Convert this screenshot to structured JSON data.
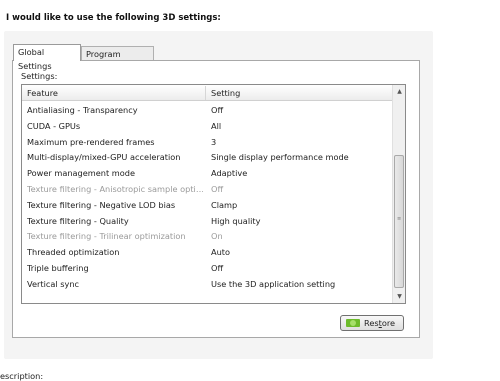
{
  "heading": "I would like to use the following 3D settings:",
  "tabs": [
    {
      "label": "Global Settings",
      "active": true
    },
    {
      "label": "Program Settings",
      "active": false
    }
  ],
  "settings_label": "Settings:",
  "columns": {
    "feature": "Feature",
    "setting": "Setting"
  },
  "rows": [
    {
      "feature": "Antialiasing - Transparency",
      "value": "Off",
      "disabled": false
    },
    {
      "feature": "CUDA - GPUs",
      "value": "All",
      "disabled": false
    },
    {
      "feature": "Maximum pre-rendered frames",
      "value": "3",
      "disabled": false
    },
    {
      "feature": "Multi-display/mixed-GPU acceleration",
      "value": "Single display performance mode",
      "disabled": false
    },
    {
      "feature": "Power management mode",
      "value": "Adaptive",
      "disabled": false
    },
    {
      "feature": "Texture filtering - Anisotropic sample opti…",
      "value": "Off",
      "disabled": true
    },
    {
      "feature": "Texture filtering - Negative LOD bias",
      "value": "Clamp",
      "disabled": false
    },
    {
      "feature": "Texture filtering - Quality",
      "value": "High quality",
      "disabled": false
    },
    {
      "feature": "Texture filtering - Trilinear optimization",
      "value": "On",
      "disabled": true
    },
    {
      "feature": "Threaded optimization",
      "value": "Auto",
      "disabled": false
    },
    {
      "feature": "Triple buffering",
      "value": "Off",
      "disabled": false
    },
    {
      "feature": "Vertical sync",
      "value": "Use the 3D application setting",
      "disabled": false
    }
  ],
  "restore_button": {
    "label_pre": "Res",
    "label_u": "t",
    "label_post": "ore",
    "icon": "nvidia-logo-icon"
  },
  "description_label": "escription:",
  "colors": {
    "panel": "#f4f4f4",
    "disabled_text": "#9a9a9a",
    "icon_green": "#6dbb2b"
  }
}
